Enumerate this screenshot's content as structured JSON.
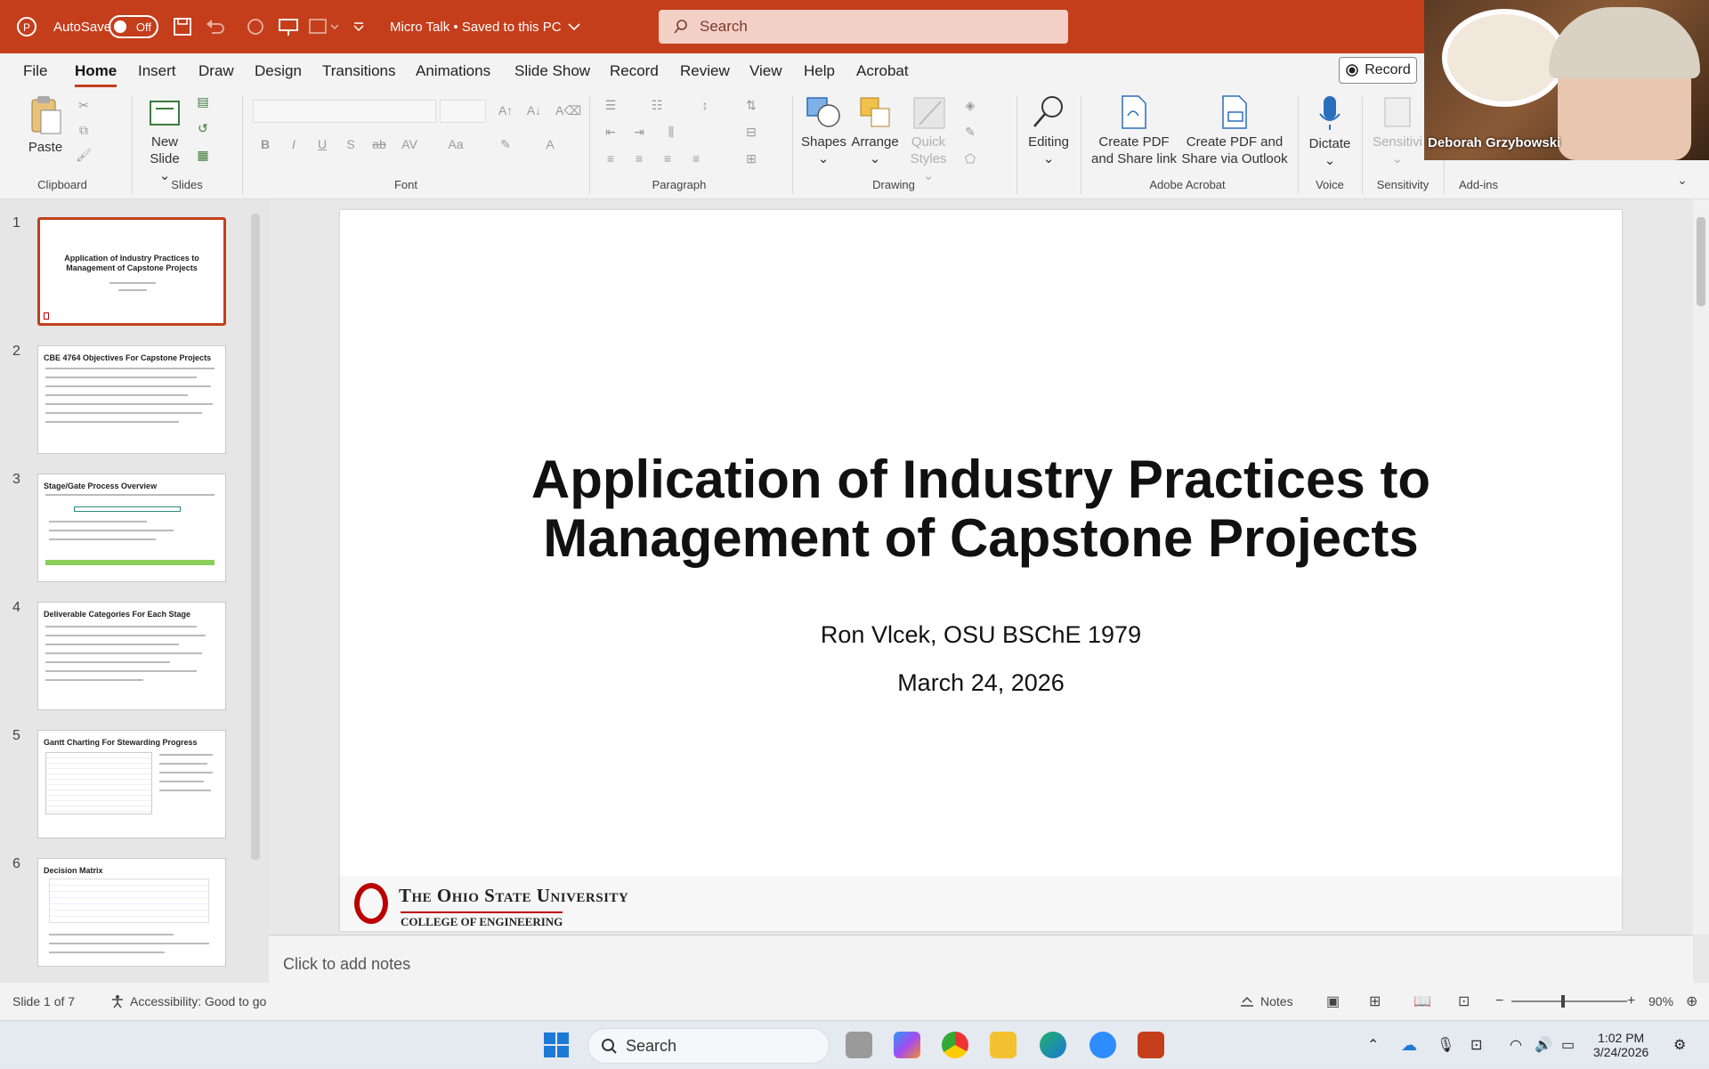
{
  "titlebar": {
    "autosave_label": "AutoSave",
    "autosave_state": "Off",
    "doc_title": "Micro Talk • Saved to this PC",
    "search_placeholder": "Search"
  },
  "menu": {
    "tabs": [
      "File",
      "Home",
      "Insert",
      "Draw",
      "Design",
      "Transitions",
      "Animations",
      "Slide Show",
      "Record",
      "Review",
      "View",
      "Help",
      "Acrobat"
    ],
    "active": "Home",
    "record_button": "Record"
  },
  "ribbon": {
    "paste": "Paste",
    "new_slide_line1": "New",
    "new_slide_line2": "Slide",
    "shapes": "Shapes",
    "arrange": "Arrange",
    "quick_styles_line1": "Quick",
    "quick_styles_line2": "Styles",
    "editing": "Editing",
    "create_pdf_share_line1": "Create PDF",
    "create_pdf_share_line2": "and Share link",
    "create_pdf_outlook_line1": "Create PDF and",
    "create_pdf_outlook_line2": "Share via Outlook",
    "dictate": "Dictate",
    "sensitivity": "Sensitivi",
    "groups": {
      "clipboard": "Clipboard",
      "slides": "Slides",
      "font": "Font",
      "paragraph": "Paragraph",
      "drawing": "Drawing",
      "adobe": "Adobe Acrobat",
      "voice": "Voice",
      "sensitivity": "Sensitivity",
      "addins": "Add-ins"
    }
  },
  "thumbnails": [
    {
      "num": "1",
      "title": "Application of Industry Practices to Management of Capstone Projects"
    },
    {
      "num": "2",
      "title": "CBE 4764 Objectives For Capstone Projects"
    },
    {
      "num": "3",
      "title": "Stage/Gate Process Overview"
    },
    {
      "num": "4",
      "title": "Deliverable Categories For Each Stage"
    },
    {
      "num": "5",
      "title": "Gantt Charting For Stewarding Progress"
    },
    {
      "num": "6",
      "title": "Decision Matrix"
    }
  ],
  "slide": {
    "title_line1": "Application of Industry Practices to",
    "title_line2": "Management of Capstone Projects",
    "author": "Ron Vlcek, OSU BSChE 1979",
    "date": "March 24, 2026",
    "osu_line1": "The Ohio State University",
    "osu_line2": "COLLEGE OF ENGINEERING"
  },
  "notes_placeholder": "Click to add notes",
  "status": {
    "slide_counter": "Slide 1 of 7",
    "accessibility": "Accessibility: Good to go",
    "notes": "Notes",
    "zoom": "90%"
  },
  "taskbar": {
    "search": "Search",
    "time": "1:02 PM",
    "date": "3/24/2026"
  },
  "video": {
    "participant": "Deborah Grzybowski"
  },
  "colors": {
    "accent": "#c43e1c",
    "osu_red": "#bb0000"
  }
}
